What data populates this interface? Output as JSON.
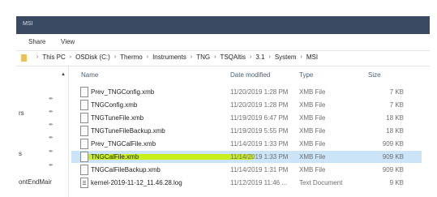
{
  "window": {
    "title": "MSI"
  },
  "ribbon": {
    "tabs": [
      "Share",
      "View"
    ]
  },
  "address": {
    "crumbs": [
      "This PC",
      "OSDisk (C:)",
      "Thermo",
      "Instruments",
      "TNG",
      "TSQAltis",
      "3.1",
      "System",
      "MSI"
    ]
  },
  "navpane": {
    "items": [
      "rs",
      "s",
      "ontEndMair"
    ]
  },
  "columns": {
    "name": "Name",
    "date": "Date modified",
    "type": "Type",
    "size": "Size"
  },
  "files": [
    {
      "name": "Prev_TNGConfig.xmb",
      "date": "11/20/2019 1:28 PM",
      "type": "XMB File",
      "size": "7 KB",
      "selected": false
    },
    {
      "name": "TNGConfig.xmb",
      "date": "11/20/2019 1:28 PM",
      "type": "XMB File",
      "size": "7 KB",
      "selected": false
    },
    {
      "name": "TNGTuneFile.xmb",
      "date": "11/19/2019 6:47 PM",
      "type": "XMB File",
      "size": "18 KB",
      "selected": false
    },
    {
      "name": "TNGTuneFileBackup.xmb",
      "date": "11/19/2019 5:55 PM",
      "type": "XMB File",
      "size": "18 KB",
      "selected": false
    },
    {
      "name": "Prev_TNGCalFile.xmb",
      "date": "11/14/2019 1:33 PM",
      "type": "XMB File",
      "size": "909 KB",
      "selected": false
    },
    {
      "name": "TNGCalFile.xmb",
      "date": "11/14/2019 1:33 PM",
      "type": "XMB File",
      "size": "909 KB",
      "selected": true
    },
    {
      "name": "TNGCalFileBackup.xmb",
      "date": "11/14/2019 1:31 PM",
      "type": "XMB File",
      "size": "909 KB",
      "selected": false
    },
    {
      "name": "kernel-2019-11-12_11.46.28.log",
      "date": "11/12/2019 11:46 ...",
      "type": "Text Document",
      "size": "9 KB",
      "selected": false
    }
  ]
}
